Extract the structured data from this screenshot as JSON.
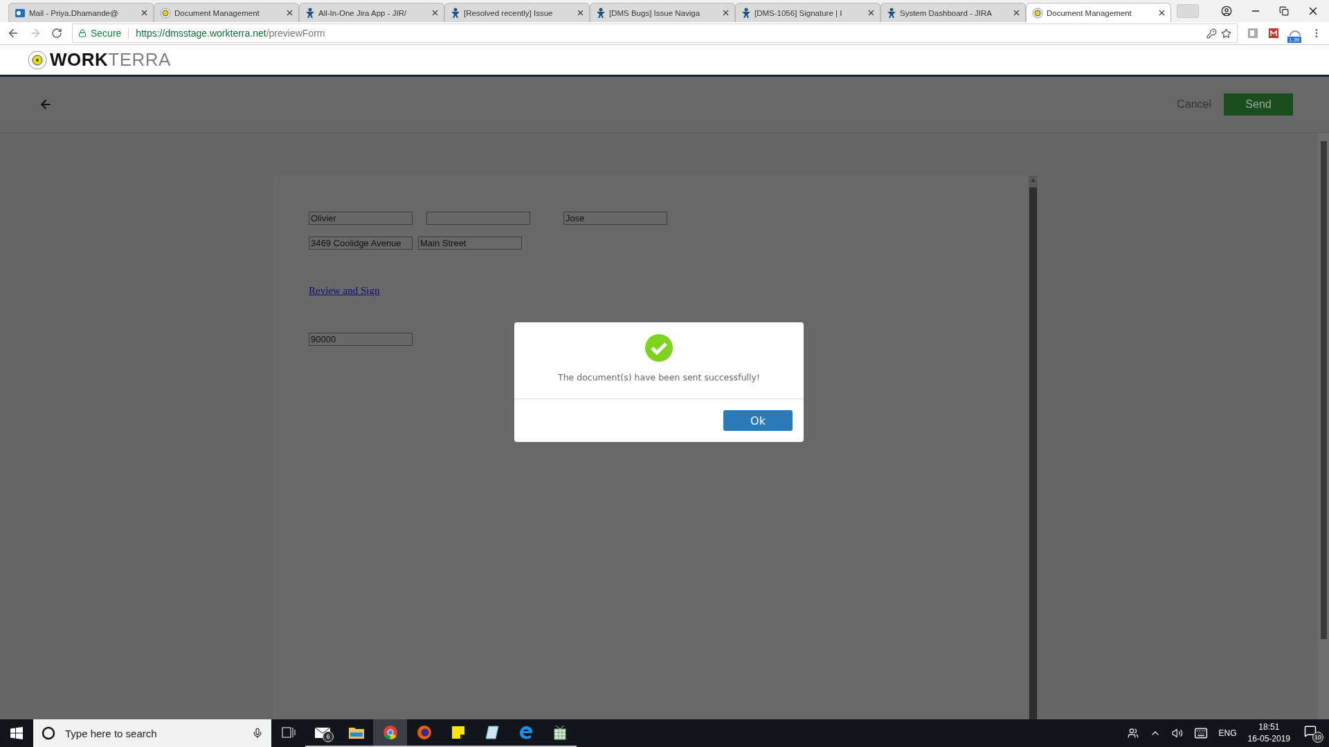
{
  "browser": {
    "tabs": [
      {
        "title": "Mail - Priya.Dhamande@",
        "kind": "mail",
        "selected": false
      },
      {
        "title": "Document Management",
        "kind": "workterra",
        "selected": false
      },
      {
        "title": "All-In-One Jira App - JIR/",
        "kind": "jira",
        "selected": false
      },
      {
        "title": "[Resolved recently] Issue",
        "kind": "jira",
        "selected": false
      },
      {
        "title": "[DMS Bugs] Issue Naviga",
        "kind": "jira",
        "selected": false
      },
      {
        "title": "[DMS-1056] Signature | I",
        "kind": "jira",
        "selected": false
      },
      {
        "title": "System Dashboard - JIRA",
        "kind": "jira",
        "selected": false
      },
      {
        "title": "Document Management",
        "kind": "workterra",
        "selected": true
      }
    ],
    "address": {
      "secure_label": "Secure",
      "url_host": "https://dmsstage.workterra.net",
      "url_path": "/previewForm"
    },
    "extension_badge": "1.39"
  },
  "app": {
    "logo": {
      "bold": "WORK",
      "light": "TERRA"
    },
    "toolbar": {
      "cancel": "Cancel",
      "send": "Send"
    },
    "form": {
      "rows": [
        [
          "Olivier",
          "",
          "Jose"
        ],
        [
          "3469 Coolidge Avenue",
          "Main Street"
        ]
      ],
      "link": "Review and Sign",
      "amount": "90000"
    },
    "dialog": {
      "message": "The document(s) have been sent successfully!",
      "button": "Ok"
    }
  },
  "taskbar": {
    "search_placeholder": "Type here to search",
    "apps": [
      {
        "kind": "mail",
        "badge": "6"
      },
      {
        "kind": "folder"
      },
      {
        "kind": "chrome",
        "selected": true
      },
      {
        "kind": "firefox"
      },
      {
        "kind": "sticky"
      },
      {
        "kind": "notepad"
      },
      {
        "kind": "edge"
      },
      {
        "kind": "spreadsheet"
      }
    ],
    "language": "ENG",
    "time": "18:51",
    "date": "16-05-2019",
    "notifications": "10"
  }
}
